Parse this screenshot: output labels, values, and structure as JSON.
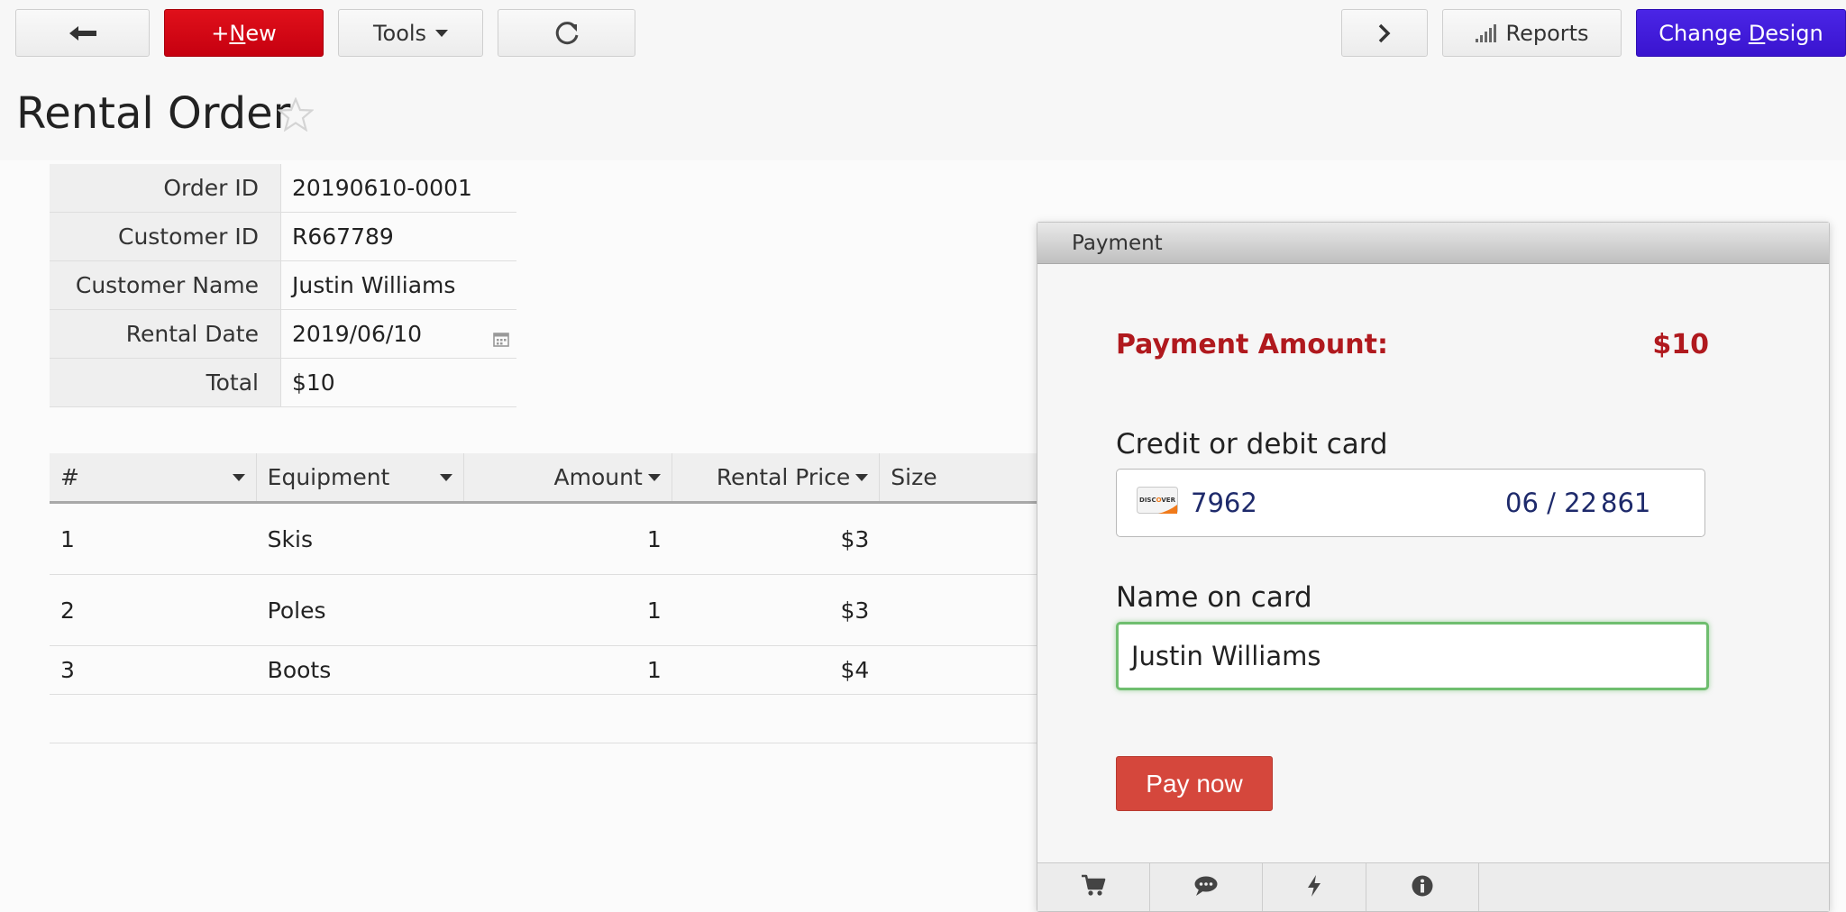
{
  "toolbar": {
    "back_icon": "arrow-left-icon",
    "new_label": {
      "prefix": "+",
      "underlined": "N",
      "rest": "ew"
    },
    "tools_label": "Tools",
    "refresh_icon": "refresh-icon",
    "next_icon": "chevron-right-icon",
    "reports_label": "Reports",
    "change_design_label": {
      "before": "Change ",
      "underlined": "D",
      "rest": "esign"
    },
    "colors": {
      "new": "#d4000f",
      "change_design": "#4020dc"
    }
  },
  "page": {
    "title": "Rental Order"
  },
  "order": {
    "fields": [
      {
        "label": "Order ID",
        "value": "20190610-0001"
      },
      {
        "label": "Customer ID",
        "value": "R667789"
      },
      {
        "label": "Customer Name",
        "value": "Justin Williams"
      },
      {
        "label": "Rental Date",
        "value": "2019/06/10"
      },
      {
        "label": "Total",
        "value": "$10"
      }
    ]
  },
  "grid": {
    "headers": [
      "#",
      "Equipment",
      "Amount",
      "Rental Price",
      "Size"
    ],
    "rows": [
      [
        "1",
        "Skis",
        "1",
        "$3"
      ],
      [
        "2",
        "Poles",
        "1",
        "$3"
      ],
      [
        "3",
        "Boots",
        "1",
        "$4"
      ]
    ]
  },
  "payment": {
    "title": "Payment",
    "amount_label": "Payment Amount:",
    "amount_value": "$10",
    "card_label": "Credit or debit card",
    "card_number": "7962",
    "card_expiry": "06 / 22",
    "card_cvc": "861",
    "card_brand_icon": "discover-card-icon",
    "name_label": "Name on card",
    "name_value": "Justin Williams",
    "pay_button": "Pay now",
    "accent_color": "#b0191e"
  },
  "footer_icons": [
    "cart-icon",
    "comment-icon",
    "lightning-icon",
    "info-icon"
  ]
}
